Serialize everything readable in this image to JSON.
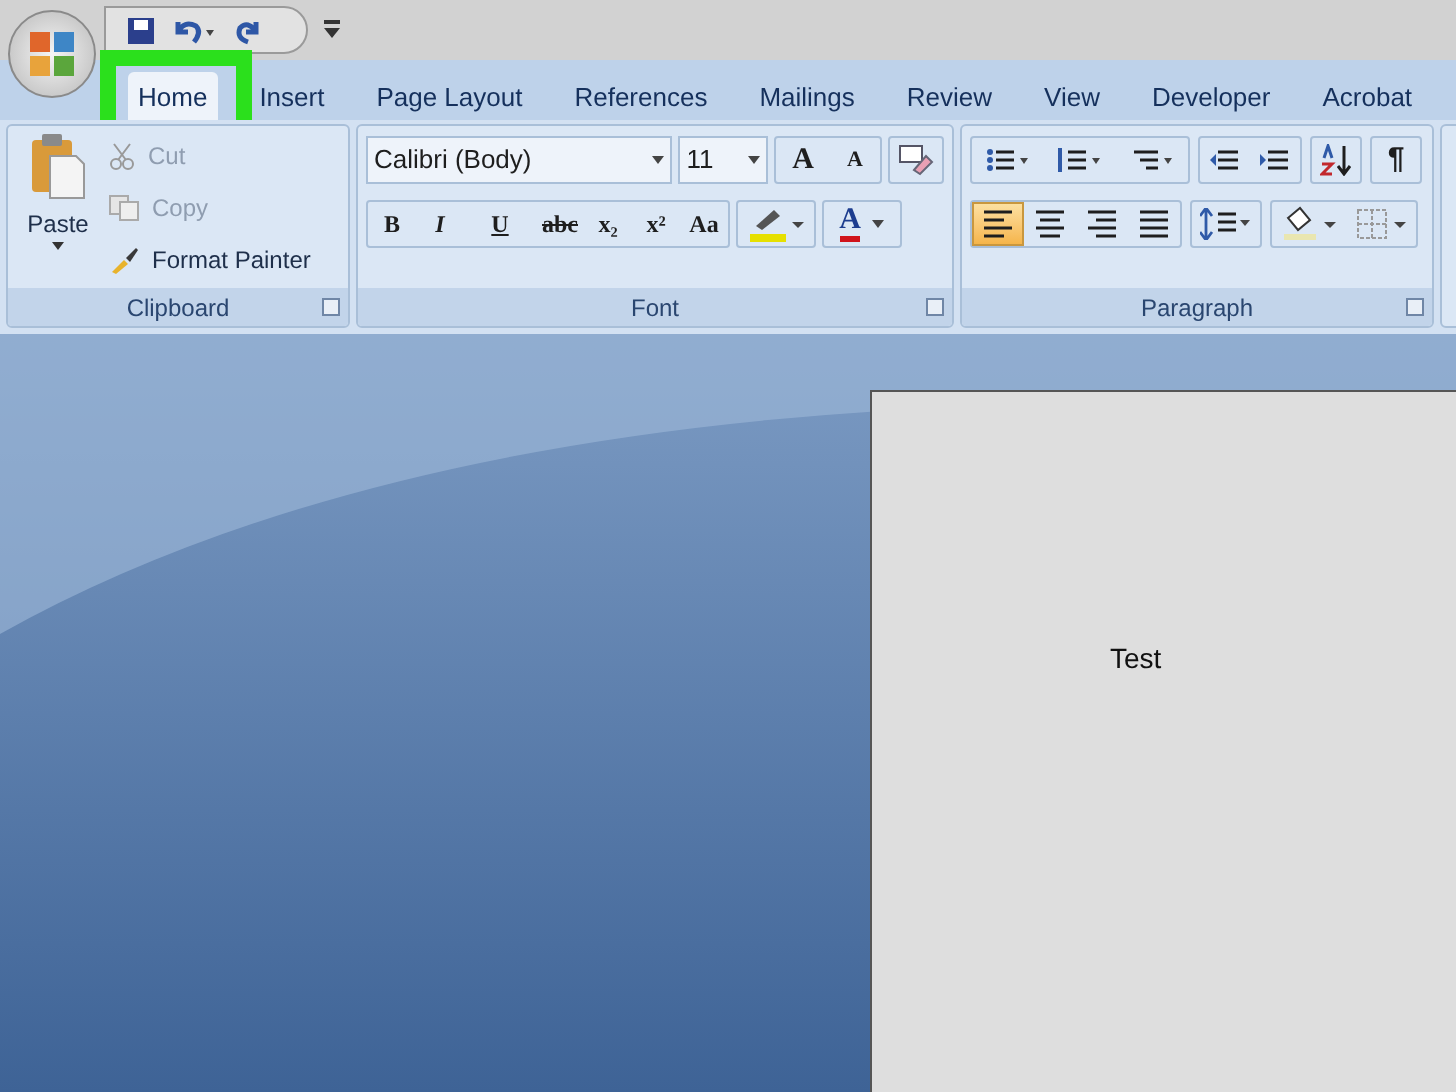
{
  "tabs": [
    {
      "label": "Home",
      "selected": true
    },
    {
      "label": "Insert",
      "selected": false
    },
    {
      "label": "Page Layout",
      "selected": false
    },
    {
      "label": "References",
      "selected": false
    },
    {
      "label": "Mailings",
      "selected": false
    },
    {
      "label": "Review",
      "selected": false
    },
    {
      "label": "View",
      "selected": false
    },
    {
      "label": "Developer",
      "selected": false
    },
    {
      "label": "Acrobat",
      "selected": false
    }
  ],
  "clipboard": {
    "title": "Clipboard",
    "paste": "Paste",
    "items": [
      {
        "label": "Cut",
        "disabled": true
      },
      {
        "label": "Copy",
        "disabled": true
      },
      {
        "label": "Format Painter",
        "disabled": false
      }
    ]
  },
  "font": {
    "title": "Font",
    "font_name": "Calibri (Body)",
    "font_size": "11",
    "grow": "A",
    "shrink": "A",
    "format_buttons": [
      "B",
      "I",
      "U",
      "abc",
      "x₂",
      "x²",
      "Aa"
    ],
    "font_color": "A"
  },
  "paragraph": {
    "title": "Paragraph",
    "show_marks": "¶",
    "alignments": [
      {
        "selected": true
      },
      {
        "selected": false
      },
      {
        "selected": false
      },
      {
        "selected": false
      }
    ]
  },
  "document": {
    "text": "Test"
  }
}
